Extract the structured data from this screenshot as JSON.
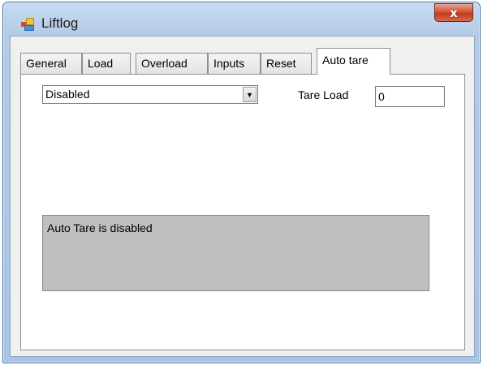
{
  "window": {
    "title": "Liftlog",
    "close_glyph": "x"
  },
  "tabs": [
    {
      "label": "General",
      "active": false
    },
    {
      "label": "Load",
      "active": false
    },
    {
      "label": "Overload",
      "active": false
    },
    {
      "label": "Inputs",
      "active": false
    },
    {
      "label": "Reset",
      "active": false
    },
    {
      "label": "Auto tare",
      "active": true
    }
  ],
  "auto_tare": {
    "mode_value": "Disabled",
    "dropdown_icon": "chevron-down-icon",
    "tare_load_label": "Tare Load",
    "tare_load_value": "0",
    "status_text": "Auto Tare is disabled"
  },
  "colors": {
    "title_bar": "#b4cbe6",
    "close_button": "#c23b1c",
    "status_box": "#bfbfbf"
  }
}
